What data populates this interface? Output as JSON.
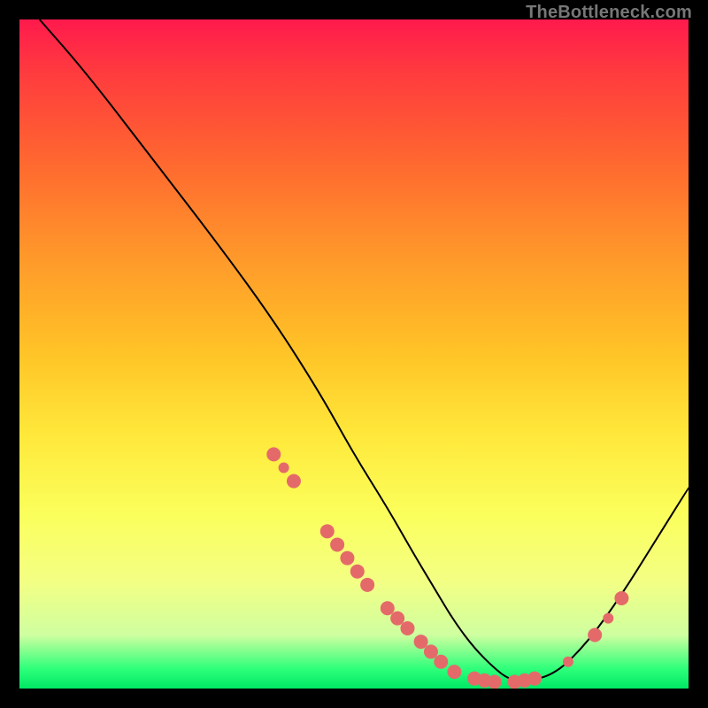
{
  "watermark": "TheBottleneck.com",
  "colors": {
    "dot": "#e46a6a",
    "curve": "#000000",
    "gradient_top": "#ff1a4d",
    "gradient_bottom": "#00e865"
  },
  "chart_data": {
    "type": "line",
    "title": "",
    "xlabel": "",
    "ylabel": "",
    "xlim": [
      0,
      100
    ],
    "ylim": [
      0,
      100
    ],
    "grid": false,
    "series": [
      {
        "name": "curve",
        "x": [
          3,
          10,
          20,
          30,
          38,
          45,
          50,
          55,
          59,
          62,
          65,
          68,
          71,
          73,
          75,
          80,
          85,
          90,
          95,
          100
        ],
        "y": [
          100,
          92,
          79,
          66,
          55,
          44,
          35,
          27,
          20,
          15,
          10,
          6,
          3,
          1.5,
          1,
          2,
          7,
          14,
          22,
          30
        ]
      }
    ],
    "markers": [
      {
        "x": 38,
        "y": 35,
        "size": "big"
      },
      {
        "x": 39.5,
        "y": 33,
        "size": "med"
      },
      {
        "x": 41,
        "y": 31,
        "size": "big"
      },
      {
        "x": 46,
        "y": 23.5,
        "size": "big"
      },
      {
        "x": 47.5,
        "y": 21.5,
        "size": "big"
      },
      {
        "x": 49,
        "y": 19.5,
        "size": "big"
      },
      {
        "x": 50.5,
        "y": 17.5,
        "size": "big"
      },
      {
        "x": 52,
        "y": 15.5,
        "size": "big"
      },
      {
        "x": 55,
        "y": 12,
        "size": "big"
      },
      {
        "x": 56.5,
        "y": 10.5,
        "size": "big"
      },
      {
        "x": 58,
        "y": 9,
        "size": "big"
      },
      {
        "x": 60,
        "y": 7,
        "size": "big"
      },
      {
        "x": 61.5,
        "y": 5.5,
        "size": "big"
      },
      {
        "x": 63,
        "y": 4,
        "size": "big"
      },
      {
        "x": 65,
        "y": 2.5,
        "size": "big"
      },
      {
        "x": 68,
        "y": 1.5,
        "size": "big"
      },
      {
        "x": 69.5,
        "y": 1.2,
        "size": "big"
      },
      {
        "x": 71,
        "y": 1,
        "size": "big"
      },
      {
        "x": 74,
        "y": 1,
        "size": "big"
      },
      {
        "x": 75.5,
        "y": 1.2,
        "size": "big"
      },
      {
        "x": 77,
        "y": 1.5,
        "size": "big"
      },
      {
        "x": 82,
        "y": 4,
        "size": "med"
      },
      {
        "x": 86,
        "y": 8,
        "size": "big"
      },
      {
        "x": 88,
        "y": 10.5,
        "size": "med"
      },
      {
        "x": 90,
        "y": 13.5,
        "size": "big"
      }
    ]
  }
}
